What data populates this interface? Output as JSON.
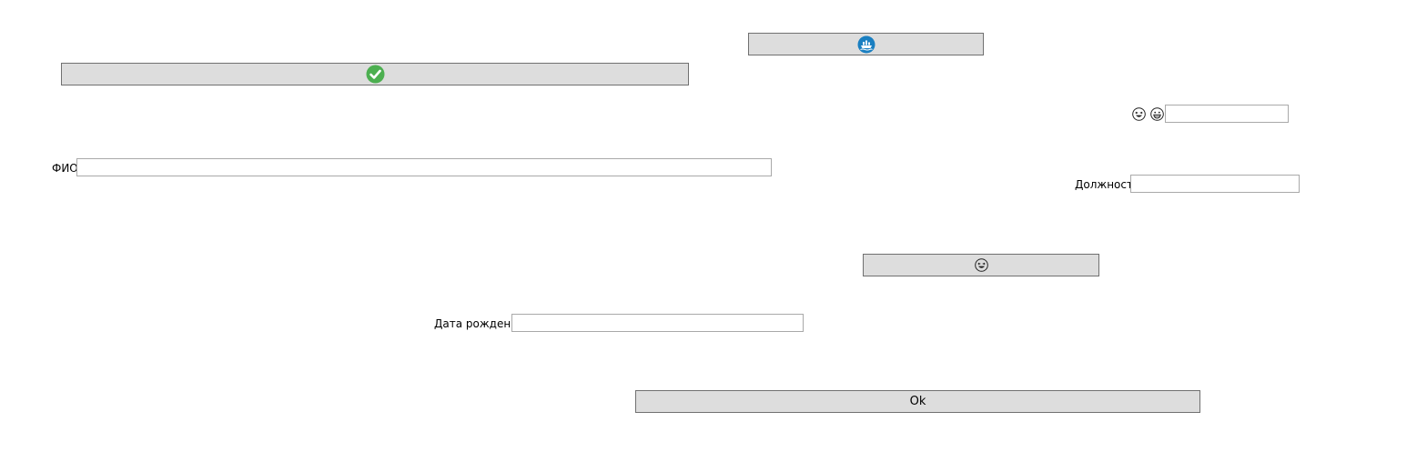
{
  "buttons": {
    "top_right": {
      "icon": "ship-icon"
    },
    "top_left": {
      "icon": "check-circle-icon"
    },
    "middle": {
      "icon": "laughing-face-icon"
    },
    "ok": {
      "label": "Ok",
      "icon": ""
    }
  },
  "emoji_pair": {
    "first": "laughing-face-icon",
    "second": "grinning-face-icon"
  },
  "fields": {
    "fio": {
      "label": "ФИО",
      "value": "",
      "placeholder": ""
    },
    "position": {
      "label": "Должность",
      "value": "",
      "placeholder": ""
    },
    "birth_date": {
      "label": "Дата рождения",
      "value": "",
      "placeholder": ""
    },
    "emoji_field": {
      "value": "",
      "placeholder": ""
    }
  },
  "colors": {
    "button_bg": "#dddddd",
    "button_border": "#707070",
    "field_border": "#a9a9a9",
    "check_green": "#4caf50",
    "ship_blue": "#1a7fc1"
  }
}
